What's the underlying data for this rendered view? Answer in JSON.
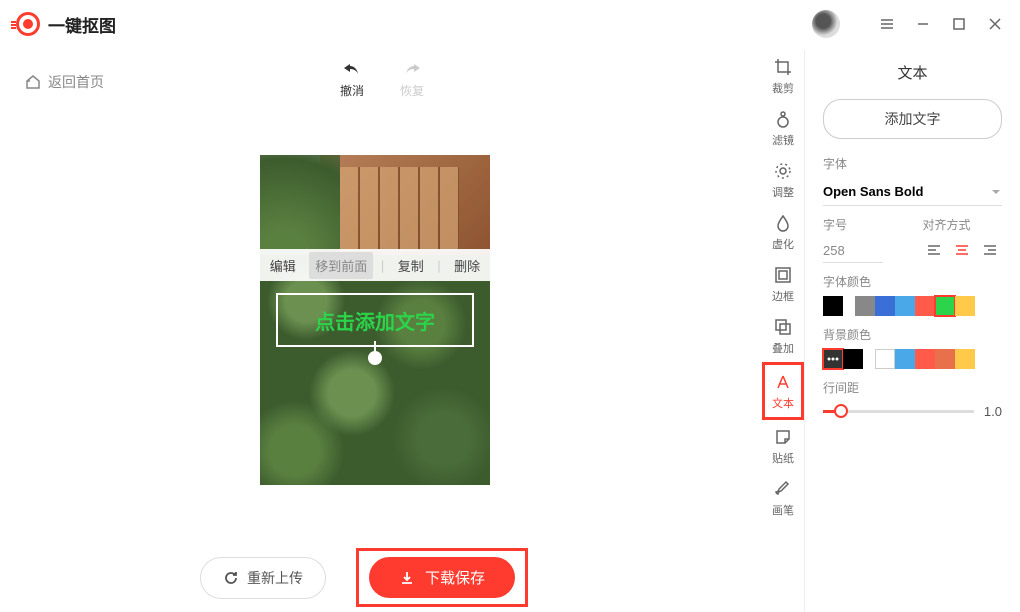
{
  "app": {
    "title": "一键抠图"
  },
  "nav": {
    "back_home": "返回首页"
  },
  "history": {
    "undo": "撤消",
    "redo": "恢复"
  },
  "canvas": {
    "context_menu": {
      "edit": "编辑",
      "bring_front": "移到前面",
      "copy": "复制",
      "delete": "删除"
    },
    "text_placeholder": "点击添加文字"
  },
  "actions": {
    "reupload": "重新上传",
    "download": "下载保存"
  },
  "rail": {
    "crop": "裁剪",
    "filter": "滤镜",
    "adjust": "调整",
    "blur": "虚化",
    "border": "边框",
    "overlay": "叠加",
    "text": "文本",
    "sticker": "贴纸",
    "brush": "画笔"
  },
  "panel": {
    "title": "文本",
    "add_text": "添加文字",
    "font_label": "字体",
    "font_value": "Open Sans Bold",
    "size_label": "字号",
    "size_value": "258",
    "align_label": "对齐方式",
    "font_color_label": "字体颜色",
    "bg_color_label": "背景颜色",
    "line_spacing_label": "行间距",
    "line_spacing_value": "1.0",
    "font_colors": [
      "#000000",
      "gap",
      "#888888",
      "#3a6fd8",
      "#4aa8e8",
      "#ff5a4a",
      "#2bd44a",
      "#ffc94a"
    ],
    "bg_colors": [
      "#333333",
      "#000000",
      "gap",
      "#ffffff",
      "#4aa8e8",
      "#ff5a4a",
      "#e8704a",
      "#ffc94a"
    ],
    "font_color_selected": 6,
    "bg_color_selected": 0,
    "slider_percent": 12
  }
}
